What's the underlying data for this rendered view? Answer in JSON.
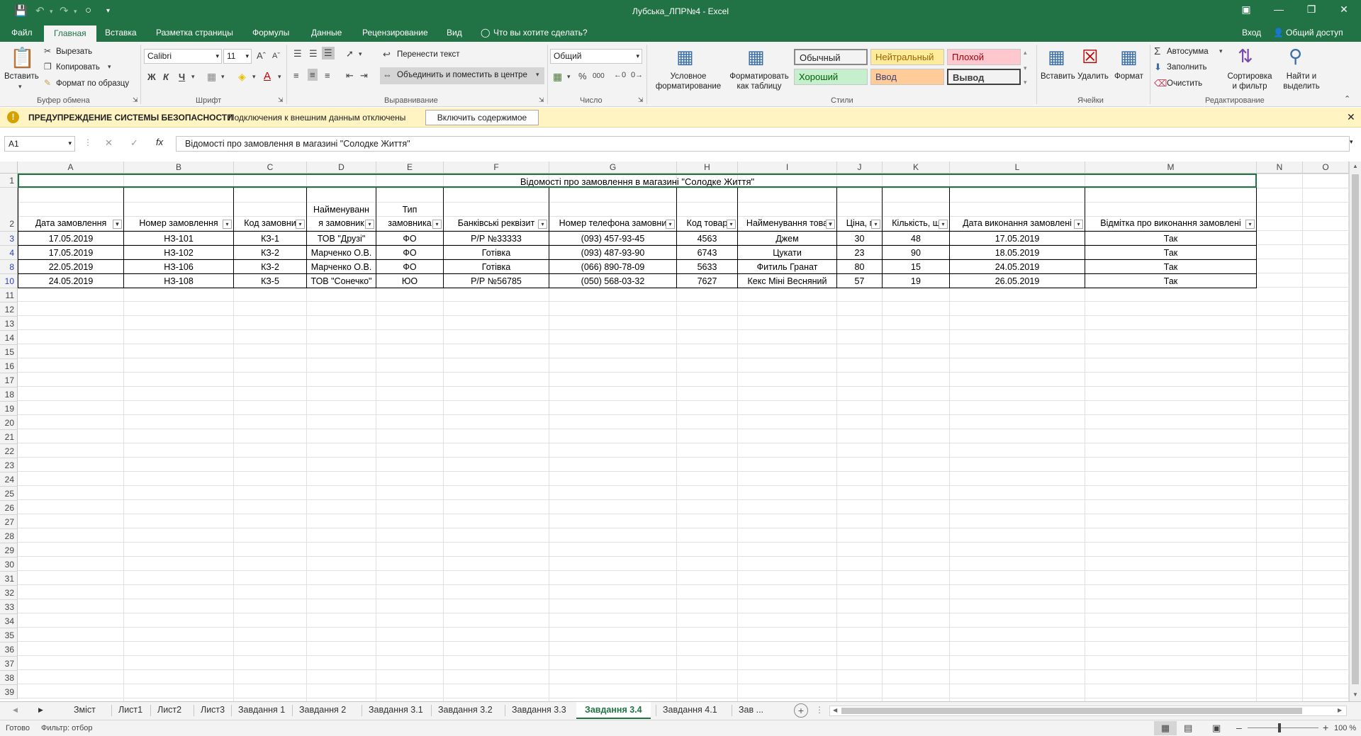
{
  "titlebar": {
    "title": "Лубська_ЛПР№4  -  Excel",
    "save_icon": "save-icon",
    "undo_icon": "undo-icon",
    "redo_icon": "redo-icon"
  },
  "tabs": [
    {
      "label": "Файл"
    },
    {
      "label": "Главная"
    },
    {
      "label": "Вставка"
    },
    {
      "label": "Разметка страницы"
    },
    {
      "label": "Формулы"
    },
    {
      "label": "Данные"
    },
    {
      "label": "Рецензирование"
    },
    {
      "label": "Вид"
    }
  ],
  "tell_me": "Что вы хотите сделать?",
  "account": {
    "signin": "Вход",
    "share": "Общий доступ"
  },
  "ribbon": {
    "clipboard": {
      "paste": "Вставить",
      "cut": "Вырезать",
      "copy": "Копировать",
      "format_painter": "Формат по образцу",
      "label": "Буфер обмена"
    },
    "font": {
      "name": "Calibri",
      "size": "11",
      "label": "Шрифт",
      "bold": "Ж",
      "italic": "К",
      "underline": "Ч"
    },
    "alignment": {
      "wrap": "Перенести текст",
      "merge": "Объединить и поместить в центре",
      "label": "Выравнивание"
    },
    "number": {
      "format": "Общий",
      "label": "Число",
      "percent": "%",
      "thousands": "000"
    },
    "styles": {
      "conditional": "Условное форматирование",
      "format_table": "Форматировать как таблицу",
      "label": "Стили",
      "cells": [
        {
          "name": "Обычный",
          "bg": "#ffffff",
          "fg": "#000000"
        },
        {
          "name": "Нейтральный",
          "bg": "#ffeb9c",
          "fg": "#9c6500"
        },
        {
          "name": "Плохой",
          "bg": "#ffc7ce",
          "fg": "#9c0006"
        },
        {
          "name": "Хороший",
          "bg": "#c6efce",
          "fg": "#006100"
        },
        {
          "name": "Ввод",
          "bg": "#ffcc99",
          "fg": "#3f3f76"
        },
        {
          "name": "Вывод",
          "bg": "#f2f2f2",
          "fg": "#3f3f3f"
        }
      ]
    },
    "cells": {
      "insert": "Вставить",
      "delete": "Удалить",
      "format": "Формат",
      "label": "Ячейки"
    },
    "editing": {
      "autosum": "Автосумма",
      "fill": "Заполнить",
      "clear": "Очистить",
      "sort": "Сортировка и фильтр",
      "find": "Найти и выделить",
      "label": "Редактирование"
    }
  },
  "security": {
    "title": "ПРЕДУПРЕЖДЕНИЕ СИСТЕМЫ БЕЗОПАСНОСТИ",
    "message": "Подключения к внешним данным отключены",
    "button": "Включить содержимое"
  },
  "formula_bar": {
    "name_box": "A1",
    "fx": "fx",
    "content": "Відомості про замовлення в магазині \"Солодке Життя\""
  },
  "columns": [
    "A",
    "B",
    "C",
    "D",
    "E",
    "F",
    "G",
    "H",
    "I",
    "J",
    "K",
    "L",
    "M",
    "N",
    "O"
  ],
  "sheet": {
    "title": "Відомості про замовлення в магазині \"Солодке Життя\"",
    "headers": [
      "Дата замовлення",
      "Номер замовлення",
      "Код замовни",
      "Найменуванн\nя замовник",
      "Тип\nзамовника",
      "Банківські реквізит",
      "Номер телефона замовни",
      "Код товар",
      "Найменування това",
      "Ціна, г",
      "Кількість, ш",
      "Дата виконання замовлені",
      "Відмітка про виконання замовлені"
    ],
    "rows": [
      {
        "num": "3",
        "cells": [
          "17.05.2019",
          "НЗ-101",
          "КЗ-1",
          "ТОВ \"Друзі\"",
          "ФО",
          "Р/Р №33333",
          "(093) 457-93-45",
          "4563",
          "Джем",
          "30",
          "48",
          "17.05.2019",
          "Так"
        ]
      },
      {
        "num": "4",
        "cells": [
          "17.05.2019",
          "НЗ-102",
          "КЗ-2",
          "Марченко О.В.",
          "ФО",
          "Готівка",
          "(093) 487-93-90",
          "6743",
          "Цукати",
          "23",
          "90",
          "18.05.2019",
          "Так"
        ]
      },
      {
        "num": "8",
        "cells": [
          "22.05.2019",
          "НЗ-106",
          "КЗ-2",
          "Марченко О.В.",
          "ФО",
          "Готівка",
          "(066) 890-78-09",
          "5633",
          "Фитиль Гранат",
          "80",
          "15",
          "24.05.2019",
          "Так"
        ]
      },
      {
        "num": "10",
        "cells": [
          "24.05.2019",
          "НЗ-108",
          "КЗ-5",
          "ТОВ \"Сонечко\"",
          "ЮО",
          "Р/Р №56785",
          "(050) 568-03-32",
          "7627",
          "Кекс Міні Весняний",
          "57",
          "19",
          "26.05.2019",
          "Так"
        ]
      }
    ],
    "empty_rows": [
      "11",
      "12",
      "13",
      "14",
      "15",
      "16",
      "17",
      "18",
      "19",
      "20",
      "21",
      "22",
      "23",
      "24",
      "25",
      "26",
      "27",
      "28",
      "29",
      "30",
      "31",
      "32",
      "33",
      "34",
      "35",
      "36",
      "37",
      "38",
      "39"
    ]
  },
  "sheet_tabs": [
    "Зміст",
    "Лист1",
    "Лист2",
    "Лист3",
    "Завдання 1",
    "Завдання 2",
    "Завдання 3.1",
    "Завдання 3.2",
    "Завдання 3.3",
    "Завдання 3.4",
    "Завдання 4.1",
    "Зав ..."
  ],
  "active_sheet": "Завдання 3.4",
  "status": {
    "ready": "Готово",
    "filter": "Фильтр: отбор",
    "zoom": "100 %"
  }
}
